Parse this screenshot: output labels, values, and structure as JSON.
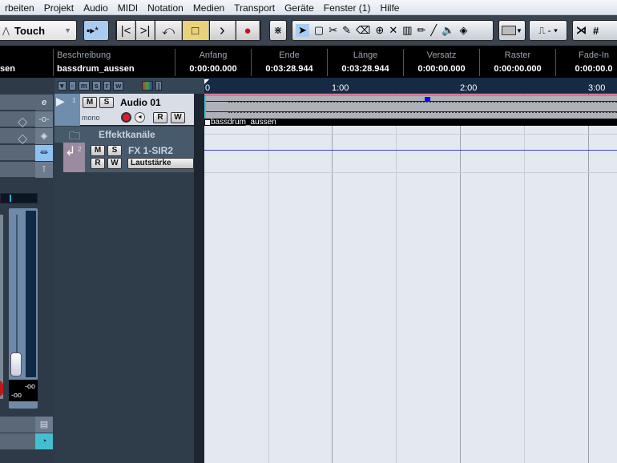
{
  "menu": [
    "rbeiten",
    "Projekt",
    "Audio",
    "MIDI",
    "Notation",
    "Medien",
    "Transport",
    "Geräte",
    "Fenster (1)",
    "Hilfe"
  ],
  "toolbar": {
    "automation_mode": "Touch",
    "transport": [
      "|<",
      ">|",
      "⤺",
      "□",
      "›",
      "●"
    ]
  },
  "infoline": {
    "name_value": "sen",
    "columns": [
      {
        "label": "Beschreibung",
        "value": "bassdrum_aussen"
      },
      {
        "label": "Anfang",
        "value": "0:00:00.000"
      },
      {
        "label": "Ende",
        "value": "0:03:28.944"
      },
      {
        "label": "Länge",
        "value": "0:03:28.944"
      },
      {
        "label": "Versatz",
        "value": "0:00:00.000"
      },
      {
        "label": "Raster",
        "value": "0:00:00.000"
      },
      {
        "label": "Fade-In",
        "value": "0:00:00.0"
      }
    ]
  },
  "tracklist_header": [
    "m",
    "s",
    "r",
    "w"
  ],
  "tracks": [
    {
      "number": "1",
      "name": "Audio 01",
      "channel": "mono",
      "m": "M",
      "s": "S",
      "r": "R",
      "w": "W"
    },
    {
      "name": "Effektkanäle"
    },
    {
      "number": "2",
      "name": "FX 1-SIR2",
      "m": "M",
      "s": "S",
      "r": "R",
      "w": "W",
      "automation": "Lautstärke"
    }
  ],
  "ruler": [
    "0",
    "1:00",
    "2:00",
    "3:00"
  ],
  "event": {
    "name": "bassdrum_aussen"
  },
  "meter": {
    "peak": "-oo",
    "level": "-oo"
  },
  "colors": {
    "accent": "#e8d27a",
    "record": "#d01020",
    "selection": "#7fb8f0"
  }
}
